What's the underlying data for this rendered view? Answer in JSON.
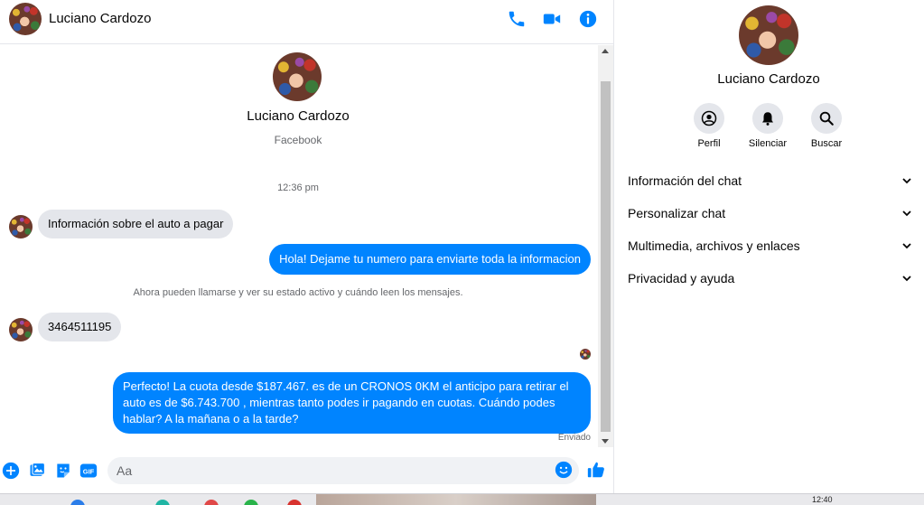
{
  "header": {
    "contact_name": "Luciano Cardozo"
  },
  "conversation": {
    "profile_name": "Luciano Cardozo",
    "profile_source": "Facebook",
    "time_separator": "12:36 pm",
    "messages": [
      {
        "direction": "in",
        "text": "Información sobre el auto a pagar"
      },
      {
        "direction": "out",
        "text": "Hola! Dejame tu numero  para enviarte toda la informacion"
      },
      {
        "direction": "system",
        "text": "Ahora pueden llamarse y ver su estado activo y cuándo leen los mensajes."
      },
      {
        "direction": "in",
        "text": "3464511195"
      },
      {
        "direction": "out",
        "text": "Perfecto! La cuota desde $187.467. es de un CRONOS 0KM el anticipo para retirar el auto es de $6.743.700 , mientras tanto podes ir pagando en cuotas. Cuándo podes hablar? A la mañana o a la tarde?"
      }
    ],
    "status": "Enviado"
  },
  "composer": {
    "placeholder": "Aa",
    "icons": [
      "plus-icon",
      "image-icon",
      "sticker-icon",
      "gif-icon",
      "emoji-icon",
      "like-icon"
    ],
    "gif_label": "GIF"
  },
  "right_panel": {
    "name": "Luciano Cardozo",
    "actions": [
      {
        "label": "Perfil",
        "icon": "profile-icon"
      },
      {
        "label": "Silenciar",
        "icon": "bell-icon"
      },
      {
        "label": "Buscar",
        "icon": "search-icon"
      }
    ],
    "sections": [
      {
        "label": "Información del chat"
      },
      {
        "label": "Personalizar chat"
      },
      {
        "label": "Multimedia, archivos y enlaces"
      },
      {
        "label": "Privacidad y ayuda"
      }
    ]
  },
  "taskbar": {
    "clock": "12:40"
  },
  "colors": {
    "accent": "#0084ff",
    "incoming_bubble": "#e4e6eb",
    "muted_text": "#65676b"
  }
}
